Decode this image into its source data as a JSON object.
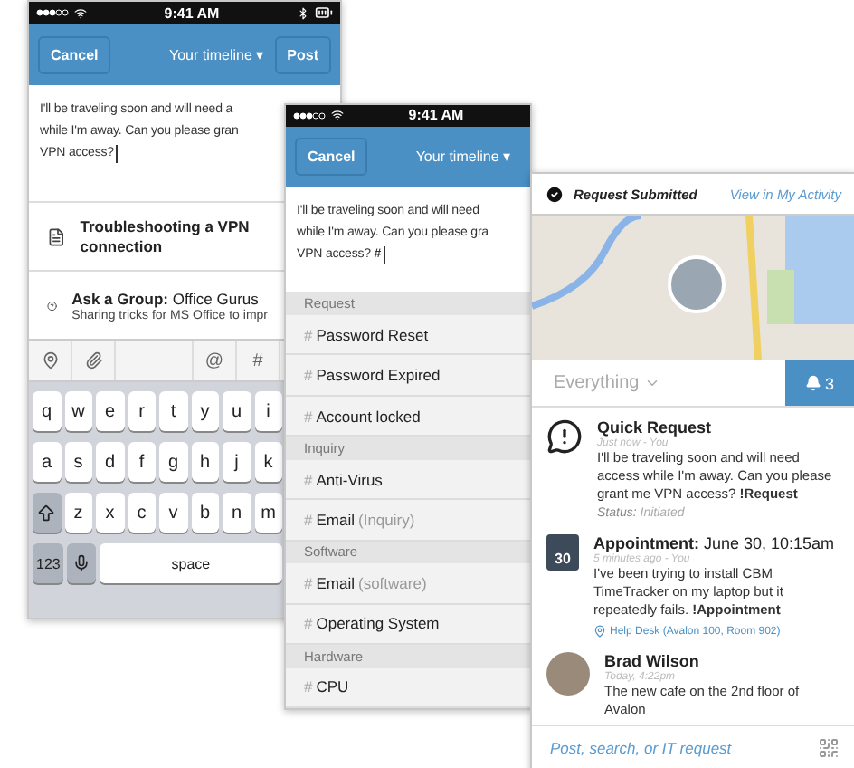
{
  "compose_screen": {
    "time": "9:41 AM",
    "cancel": "Cancel",
    "title": "Your timeline ▾",
    "post": "Post",
    "message_lines": [
      "I'll be traveling soon and will need a",
      "while I'm away. Can you please gran",
      "VPN access?"
    ],
    "suggestions": [
      {
        "kind": "article",
        "title": "Troubleshooting a VPN connection"
      },
      {
        "kind": "group",
        "title": "**Ask a Group:** Office Gurus",
        "subtitle": "Sharing tricks for MS Office to impr"
      }
    ],
    "toolbar": [
      "@",
      "#"
    ],
    "keyboard_rows": [
      [
        "q",
        "w",
        "e",
        "r",
        "t",
        "y",
        "u",
        "i"
      ],
      [
        "a",
        "s",
        "d",
        "f",
        "g",
        "h",
        "j",
        "k"
      ],
      [
        "z",
        "x",
        "c",
        "v",
        "b",
        "n",
        "m"
      ]
    ],
    "numbers_key": "123",
    "space_key": "space"
  },
  "hashtag_screen": {
    "time": "9:41 AM",
    "cancel": "Cancel",
    "title": "Your timeline ▾",
    "message_lines": [
      "I'll be traveling soon and will need",
      "while I'm away. Can you please gra",
      "VPN access? **#**"
    ],
    "sections": [
      {
        "heading": "Request",
        "items": [
          {
            "prefix": "#",
            "tag": "Password Reset"
          },
          {
            "prefix": "#",
            "tag": "Password Expired"
          },
          {
            "prefix": "#",
            "tag": "Account locked"
          }
        ]
      },
      {
        "heading": "Inquiry",
        "items": [
          {
            "prefix": "#",
            "tag": "Anti-Virus"
          },
          {
            "prefix": "#",
            "tag": "Email",
            "qualifier": "(Inquiry)"
          }
        ]
      },
      {
        "heading": "Software",
        "items": [
          {
            "prefix": "#",
            "tag": "Email",
            "qualifier": "(software)"
          },
          {
            "prefix": "#",
            "tag": "Operating System"
          }
        ]
      },
      {
        "heading": "Hardware",
        "items": [
          {
            "prefix": "#",
            "tag": "CPU"
          }
        ]
      }
    ]
  },
  "activity_screen": {
    "banner": {
      "title": "Request Submitted",
      "link": "View in My Activity"
    },
    "filter": "Everything",
    "notifications": "3",
    "feed": [
      {
        "kind": "request",
        "title": "Quick Request",
        "meta": "Just now - You",
        "body": "I'll be traveling soon and will need access while I'm away. Can you please grant me VPN access? **!Request**",
        "status_label": "Status:",
        "status": "Initiated"
      },
      {
        "kind": "appointment",
        "day": "30",
        "title": "**Appointment:** June 30, 10:15am",
        "meta": "5 minutes ago - You",
        "body": "I've been trying to install CBM TimeTracker on my laptop but it repeatedly fails. **!Appointment**",
        "location": "Help Desk (Avalon 100, Room 902)"
      },
      {
        "kind": "post",
        "title": "Brad Wilson",
        "meta": "Today, 4:22pm",
        "body": "The new cafe on the 2nd floor of Avalon"
      }
    ],
    "composer": {
      "placeholder": "Post, search, or IT request"
    }
  }
}
